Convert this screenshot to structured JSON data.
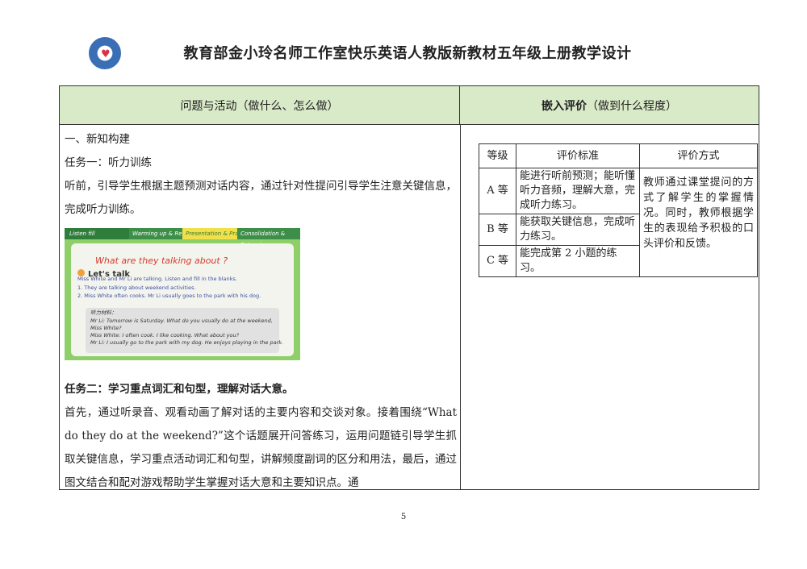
{
  "header": {
    "title": "教育部金小玲名师工作室快乐英语人教版新教材五年级上册教学设计"
  },
  "table": {
    "left_header": "问题与活动（做什么、怎么做）",
    "right_header_bold": "嵌入评价",
    "right_header_rest": "（做到什么程度）"
  },
  "content": {
    "section": "一、新知构建",
    "task1_title": "任务一：听力训练",
    "task1_text": "听前，引导学生根据主题预测对话内容，通过针对性提问引导学生注意关键信息，完成听力训练。",
    "task2_title": "任务二：学习重点词汇和句型，理解对话大意。",
    "task2_text": "首先，通过听录音、观看动画了解对话的主要内容和交谈对象。接着围绕“What do they do at the weekend?”这个话题展开问答练习，运用问题链引导学生抓取关键信息，学习重点活动词汇和句型，讲解频度副词的区分和用法，最后，通过图文结合和配对游戏帮助学生掌握对话大意和主要知识点。通"
  },
  "screenshot": {
    "tab_listen": "Listen  fill",
    "tab_warm": "Warming up & Revision",
    "tab_present": "Presentation & Practice",
    "tab_consol": "Consolidation & Extension",
    "question": "What are they talking about ?",
    "lets_talk": "Let's talk",
    "instruction": "Miss White and Mr Li are talking. Listen and fill in the blanks.",
    "item1": "1. They are talking about  weekend  activities.",
    "item2": "2. Miss White  often cooks.  Mr Li  usually goes to the park with his dog.",
    "script_label": "听力材料：",
    "script1": "Mr Li: Tomorrow is Saturday. What do you usually do at the weekend,",
    "script2": "Miss White?",
    "script3": "Miss White: I often cook. I like cooking. What about you?",
    "script4": "Mr Li: I usually go to the park with my dog. He enjoys playing in the park."
  },
  "evaluation": {
    "headers": [
      "等级",
      "评价标准",
      "评价方式"
    ],
    "rows": [
      {
        "grade": "A 等",
        "criteria": "能进行听前预测；能听懂听力音频，理解大意，完成听力练习。"
      },
      {
        "grade": "B 等",
        "criteria": "能获取关键信息，完成听力练习。"
      },
      {
        "grade": "C 等",
        "criteria": "能完成第 2 小题的练习。"
      }
    ],
    "method": "教师通过课堂提问的方式了解学生的掌握情况。同时，教师根据学生的表现给予积极的口头评价和反馈。"
  },
  "footer": {
    "page_number": "5"
  }
}
